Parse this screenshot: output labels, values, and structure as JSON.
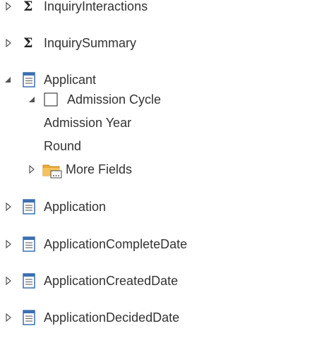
{
  "tree": {
    "measures": [
      {
        "label": "InquiryInteractions",
        "icon": "sigma-icon"
      },
      {
        "label": "InquirySummary",
        "icon": "sigma-icon"
      }
    ],
    "applicant": {
      "label": "Applicant",
      "icon": "table-icon",
      "expanded": true,
      "children": {
        "admission_cycle": {
          "label": "Admission Cycle",
          "icon": "checkbox-icon",
          "expanded": true
        },
        "admission_year": {
          "label": "Admission Year"
        },
        "round": {
          "label": "Round"
        },
        "more_fields": {
          "label": "More Fields",
          "icon": "folder-icon",
          "expanded": false
        }
      }
    },
    "tables": [
      {
        "label": "Application",
        "icon": "table-icon"
      },
      {
        "label": "ApplicationCompleteDate",
        "icon": "table-icon"
      },
      {
        "label": "ApplicationCreatedDate",
        "icon": "table-icon"
      },
      {
        "label": "ApplicationDecidedDate",
        "icon": "table-icon"
      }
    ]
  },
  "colors": {
    "text": "#333333",
    "icon_blue": "#3c6fb0",
    "folder": "#e8a93a",
    "expander": "#555555"
  }
}
